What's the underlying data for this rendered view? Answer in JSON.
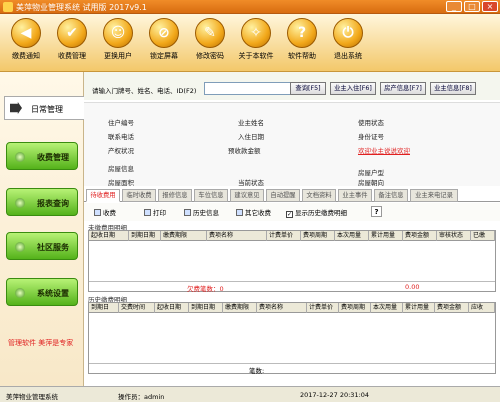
{
  "window": {
    "title": "美萍物业管理系统 试用版 2017v9.1",
    "min": "_",
    "max": "□",
    "close": "×"
  },
  "toolbar": [
    {
      "label": "缴费通知",
      "icon": "◀"
    },
    {
      "label": "收费管理",
      "icon": "✔"
    },
    {
      "label": "更换用户",
      "icon": "☺"
    },
    {
      "label": "锁定屏幕",
      "icon": "⊘"
    },
    {
      "label": "修改密码",
      "icon": "✎"
    },
    {
      "label": "关于本软件",
      "icon": "✧"
    },
    {
      "label": "软件帮助",
      "icon": "?"
    },
    {
      "label": "退出系统",
      "icon": "⏻"
    }
  ],
  "sidebar": {
    "daily": "日常管理",
    "buttons": [
      "收费管理",
      "报表查询",
      "社区服务",
      "系统设置"
    ],
    "ad": "管理软件 美萍是专家"
  },
  "search": {
    "label": "请输入门牌号、姓名、电话、ID(F2)",
    "value": ""
  },
  "buttons": [
    "查询[F5]",
    "业主入住[F6]",
    "房产信息[F7]",
    "业主信息[F8]"
  ],
  "info": {
    "f1": "住户编号",
    "f2": "业主姓名",
    "f3": "使用状态",
    "f4": "联系电话",
    "f5": "入住日期",
    "f6": "身份证号",
    "f7": "产权状况",
    "f8": "预收款金额",
    "f9": "欢迎业主说说欢迎",
    "f10": "房屋信息",
    "f11": "房屋户型",
    "f12": "房屋面积",
    "f13": "当前状态",
    "f14": "房屋朝向"
  },
  "tabs": [
    "待收费用",
    "临时收费",
    "报修信息",
    "车位信息",
    "建议意见",
    "自动提醒",
    "文档资料",
    "业主事件",
    "备注信息",
    "业主来电记录"
  ],
  "actions": {
    "a1": "收费",
    "a2": "打印",
    "a3": "历史信息",
    "a4": "其它收费",
    "a5": "显示历史缴费明细"
  },
  "pending": {
    "title": "未缴费用明细",
    "sum_label": "欠费笔数：0",
    "sum_value": "0.00",
    "columns": [
      "起收日期",
      "到期日期",
      "缴费期限",
      "费项名称",
      "计费单价",
      "费项周期",
      "本次用量",
      "累计用量",
      "费项金额",
      "审核状态",
      "已缴"
    ]
  },
  "history": {
    "title": "历史缴费明细",
    "sum_label": "笔数:",
    "columns": [
      "到期日",
      "交费时间",
      "起收日期",
      "到期日期",
      "缴费期限",
      "费项名称",
      "计费单价",
      "费项周期",
      "本次用量",
      "累计用量",
      "费项金额",
      "应收"
    ]
  },
  "status": {
    "app": "美萍物业管理系统",
    "operator": "操作员：admin",
    "datetime": "2017-12-27  20:31:04"
  },
  "colors": {
    "accent": "#f08c28",
    "green": "#54b21a",
    "alert": "#e02020"
  }
}
